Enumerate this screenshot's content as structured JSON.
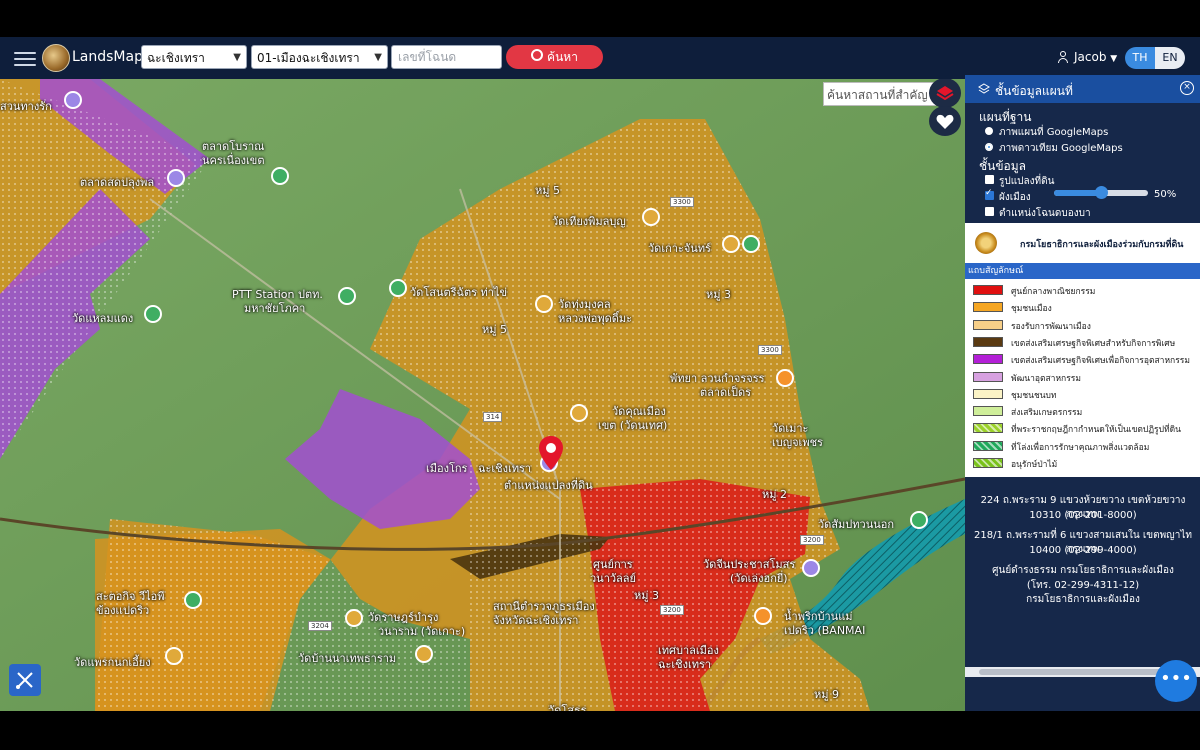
{
  "header": {
    "brand": "LandsMaps",
    "province": "ฉะเชิงเทรา",
    "district": "01-เมืองฉะเชิงเทรา",
    "deed_placeholder": "เลขที่โฉนด",
    "search_label": "ค้นหา",
    "user": "Jacob",
    "lang_th": "TH",
    "lang_en": "EN"
  },
  "map": {
    "search_placeholder": "ค้นหาสถานที่สำคัญ",
    "pin_label": "ตำแหน่งแปลงที่ดิน",
    "places": [
      "สวนทางรัก",
      "ตลาดโบราณ",
      "นครเนื่องเขต",
      "ตลาดสดปลุงพล",
      "หมู่ 5",
      "วัดเทียงพิมลบุญ",
      "วัดเกาะจันทร์",
      "PTT Station ปตท.",
      "มหาชัยโภคา",
      "วัดโสนตรีฉัตร ท่าไข่",
      "วัดแหลมแดง",
      "วัดทุ่งมุงคล",
      "หลวงพ่อพุดดิ์มะ",
      "หมู่ 5",
      "หมู่ 3",
      "พัทยา ลวนกำจรจรร",
      "ตลาดเป็ดร",
      "วัดคุณเมือง",
      "เขต (วัดนเทศ)",
      "วัดเมาะ",
      "เบญจเพชร",
      "เมืองโกร",
      "ฉะเชิงเทรา",
      "หมู่ 2",
      "วัดสัมปทวนนอก",
      "วัดจีนประชาสโมสร",
      "(วัดเล่งฮกยี่)",
      "ศูนย์การ",
      "วนาวัลลย์",
      "สถานีตำรวจภูธรเมือง",
      "จังหวัดฉะเชิงเทรา",
      "หมู่ 3",
      "สะตอกิจ วีไอพี",
      "ข้องเเปดริว",
      "วัดราษฎร์บำรุง",
      "วนาราม (วัดเกาะ)",
      "เทศบาลเมือง",
      "ฉะเชิงเทรา",
      "น้ำพริกบ้านแม่",
      "เปดริว (BANMAI",
      "หมู่ 9",
      "วัดแพรกนกเอี้ยง",
      "วัดบ้านนาเทพธาราม",
      "วัดโสธร"
    ],
    "road_signs": [
      "3300",
      "3300",
      "3200",
      "3204",
      "314",
      "3200"
    ]
  },
  "panel": {
    "title": "ชั้นข้อมูลแผนที่",
    "basemap_label": "แผนที่ฐาน",
    "basemap_options": [
      "ภาพแผนที่ GoogleMaps",
      "ภาพดาวเทียม GoogleMaps"
    ],
    "basemap_selected": 1,
    "layers_label": "ชั้นข้อมูล",
    "layers": [
      {
        "label": "รูปแปลงที่ดิน",
        "checked": false
      },
      {
        "label": "ผังเมือง",
        "checked": true
      },
      {
        "label": "ตำแหน่งโฉนดบองบา",
        "checked": false
      }
    ],
    "opacity_value": 50,
    "opacity_text": "50%",
    "dept_name": "กรมโยธาธิการและผังเมืองร่วมกับกรมที่ดิน",
    "legend_title": "แถบสัญลักษณ์",
    "legend": [
      {
        "label": "ศูนย์กลางพาณิชยกรรม",
        "color": "#e01010",
        "hatch": false
      },
      {
        "label": "ชุมชนเมือง",
        "color": "#f5a623",
        "hatch": false
      },
      {
        "label": "รองรับการพัฒนาเมือง",
        "color": "#f7cf88",
        "hatch": false
      },
      {
        "label": "เขตส่งเสริมเศรษฐกิจพิเศษสำหรับกิจการพิเศษ",
        "color": "#5a3a12",
        "hatch": false
      },
      {
        "label": "เขตส่งเสริมเศรษฐกิจพิเศษเพื่อกิจการอุตสาหกรรม",
        "color": "#b31fd6",
        "hatch": false
      },
      {
        "label": "พัฒนาอุตสาหกรรม",
        "color": "#d7a1e0",
        "hatch": false
      },
      {
        "label": "ชุมชนชนบท",
        "color": "#fbf3c6",
        "hatch": false
      },
      {
        "label": "ส่งเสริมเกษตรกรรม",
        "color": "#cfee9a",
        "hatch": false
      },
      {
        "label": "ที่พระราชกฤษฎีกากำหนดให้เป็นเขตปฏิรูปที่ดิน",
        "color": "#9bd12a",
        "hatch": true
      },
      {
        "label": "ที่โล่งเพื่อการรักษาคุณภาพสิ่งแวดล้อม",
        "color": "#1fa85a",
        "hatch": true
      },
      {
        "label": "อนุรักษ์ป่าไม้",
        "color": "#79c21a",
        "hatch": true
      }
    ],
    "addresses": [
      "224 ถ.พระราม 9 แขวงห้วยขวาง เขตห้วยขวาง กรุงเทพ",
      "10310 (02-201-8000)",
      "218/1 ถ.พระรามที่ 6 แขวงสามเสนใน เขตพญาไท กรุงเทพ",
      "10400 (02-299-4000)",
      "ศูนย์ดำรงธรรม กรมโยธาธิการและผังเมือง",
      "(โทร. 02-299-4311-12)",
      "กรมโยธาธิการและผังเมือง"
    ]
  },
  "icons": {
    "menu": "hamburger-icon",
    "search": "magnifier-icon",
    "user": "person-icon",
    "layers": "layers-icon",
    "favorite": "heart-icon",
    "tools": "ruler-pencil-icon",
    "more": "ellipsis-icon",
    "pin": "map-pin-icon"
  }
}
